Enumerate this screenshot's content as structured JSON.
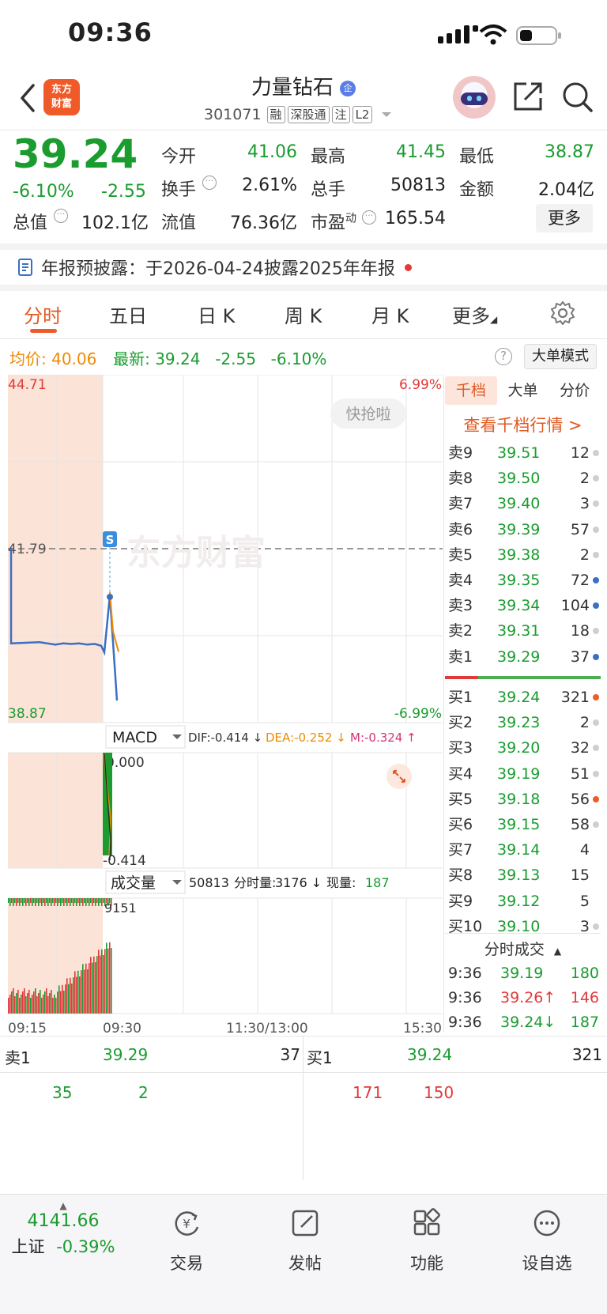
{
  "status": {
    "time": "09:36"
  },
  "header": {
    "logo_line1": "东方",
    "logo_line2": "财富",
    "name": "力量钻石",
    "code": "301071",
    "tags": [
      "融",
      "深股通",
      "注",
      "L2"
    ]
  },
  "quote": {
    "price": "39.24",
    "change_pct": "-6.10%",
    "change": "-2.55",
    "fields": {
      "open_label": "今开",
      "open": "41.06",
      "high_label": "最高",
      "high": "41.45",
      "low_label": "最低",
      "low": "38.87",
      "turnover_label": "换手",
      "turnover": "2.61%",
      "volume_label": "总手",
      "volume": "50813",
      "amount_label": "金额",
      "amount": "2.04亿",
      "mcap_label": "总值",
      "mcap": "102.1亿",
      "float_label": "流值",
      "float": "76.36亿",
      "pe_label": "市盈",
      "pe_sup": "动",
      "pe": "165.54"
    },
    "more_button": "更多"
  },
  "notice": {
    "text": "年报预披露：于2026-04-24披露2025年年报"
  },
  "tabs": [
    "分时",
    "五日",
    "日 K",
    "周 K",
    "月 K",
    "更多"
  ],
  "info_line": {
    "avg_label": "均价:",
    "avg": "40.06",
    "latest_label": "最新:",
    "latest": "39.24",
    "chg": "-2.55",
    "pct": "-6.10%",
    "big_order_button": "大单模式"
  },
  "chart": {
    "top_price": "44.71",
    "top_pct": "6.99%",
    "mid_price": "41.79",
    "bottom_price": "38.87",
    "bottom_pct": "-6.99%",
    "quick_button": "快抢啦",
    "watermark": "东方财富",
    "s_marker": "S",
    "macd_label": "MACD",
    "dif": "DIF:-0.414 ↓",
    "dea": "DEA:-0.252 ↓",
    "m": "M:-0.324 ↑",
    "macd_top": "0.000",
    "macd_bottom": "-0.414",
    "vol_label": "成交量",
    "vol_total": "50813",
    "vol_fen_label": "分时量:",
    "vol_fen": "3176 ↓",
    "vol_now_label": "现量:",
    "vol_now": "187",
    "vol_max": "9151",
    "x_ticks": [
      "09:15",
      "09:30",
      "11:30/13:00",
      "15:30"
    ],
    "colors": {
      "up": "#e03a3a",
      "down": "#1a9c2f",
      "price_line": "#3b6fc4",
      "avg_line": "#f08a00",
      "auction_bg": "#fbe3d8"
    },
    "price_series": [
      41.79,
      41.79,
      40.2,
      40.22,
      40.18,
      40.2,
      40.19,
      40.2,
      40.18,
      40.19,
      40.16,
      40.05,
      41.0,
      39.24
    ],
    "avg_series": [
      41.06,
      40.4,
      40.06
    ]
  },
  "order_book": {
    "tabs": [
      "千档",
      "大单",
      "分价"
    ],
    "link": "查看千档行情 >",
    "asks": [
      {
        "label": "卖9",
        "price": "39.51",
        "vol": "12",
        "dot": "gray"
      },
      {
        "label": "卖8",
        "price": "39.50",
        "vol": "2",
        "dot": "gray"
      },
      {
        "label": "卖7",
        "price": "39.40",
        "vol": "3",
        "dot": "gray"
      },
      {
        "label": "卖6",
        "price": "39.39",
        "vol": "57",
        "dot": "gray"
      },
      {
        "label": "卖5",
        "price": "39.38",
        "vol": "2",
        "dot": "gray"
      },
      {
        "label": "卖4",
        "price": "39.35",
        "vol": "72",
        "dot": "blue"
      },
      {
        "label": "卖3",
        "price": "39.34",
        "vol": "104",
        "dot": "blue"
      },
      {
        "label": "卖2",
        "price": "39.31",
        "vol": "18",
        "dot": "gray"
      },
      {
        "label": "卖1",
        "price": "39.29",
        "vol": "37",
        "dot": "blue"
      }
    ],
    "bids": [
      {
        "label": "买1",
        "price": "39.24",
        "vol": "321",
        "dot": "orange"
      },
      {
        "label": "买2",
        "price": "39.23",
        "vol": "2",
        "dot": "gray"
      },
      {
        "label": "买3",
        "price": "39.20",
        "vol": "32",
        "dot": "gray"
      },
      {
        "label": "买4",
        "price": "39.19",
        "vol": "51",
        "dot": "gray"
      },
      {
        "label": "买5",
        "price": "39.18",
        "vol": "56",
        "dot": "orange"
      },
      {
        "label": "买6",
        "price": "39.15",
        "vol": "58",
        "dot": "gray"
      },
      {
        "label": "买7",
        "price": "39.14",
        "vol": "4",
        "dot": "none"
      },
      {
        "label": "买8",
        "price": "39.13",
        "vol": "15",
        "dot": "none"
      },
      {
        "label": "买9",
        "price": "39.12",
        "vol": "5",
        "dot": "none"
      },
      {
        "label": "买10",
        "price": "39.10",
        "vol": "3",
        "dot": "gray"
      }
    ],
    "ticks_title": "分时成交",
    "ticks": [
      {
        "time": "9:36",
        "price": "39.19",
        "vol": "180",
        "price_color": "green",
        "vol_color": "green"
      },
      {
        "time": "9:36",
        "price": "39.26↑",
        "vol": "146",
        "price_color": "red",
        "vol_color": "red"
      },
      {
        "time": "9:36",
        "price": "39.24↓",
        "vol": "187",
        "price_color": "green",
        "vol_color": "green"
      }
    ]
  },
  "bottom_quote": {
    "sell_label": "卖1",
    "sell_price": "39.29",
    "sell_vol": "37",
    "buy_label": "买1",
    "buy_price": "39.24",
    "buy_vol": "321",
    "sell_q1": "35",
    "sell_q2": "2",
    "buy_q1": "171",
    "buy_q2": "150"
  },
  "nav": {
    "index_value": "4141.66",
    "index_name": "上证",
    "index_pct": "-0.39%",
    "items": [
      "交易",
      "发帖",
      "功能",
      "设自选"
    ]
  }
}
